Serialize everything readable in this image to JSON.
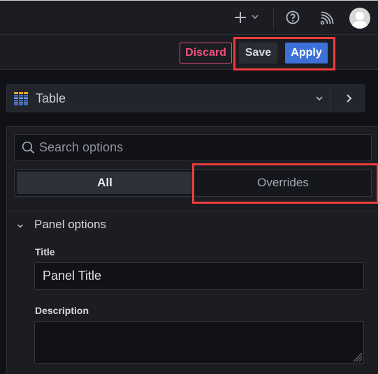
{
  "topbar": {
    "add_icon": "plus-icon",
    "add_menu_icon": "chevron-down-icon",
    "help_icon": "help-circle-icon",
    "news_icon": "rss-icon",
    "profile_icon": "avatar"
  },
  "actions": {
    "discard_label": "Discard",
    "save_label": "Save",
    "apply_label": "Apply",
    "collapse_icon": "chevron-up-icon"
  },
  "visualization": {
    "selected": "Table",
    "icon": "table-viz-icon"
  },
  "options": {
    "search_placeholder": "Search options",
    "search_value": "",
    "tabs": [
      {
        "label": "All",
        "active": true
      },
      {
        "label": "Overrides",
        "active": false
      }
    ],
    "section": {
      "title": "Panel options",
      "expanded": true,
      "fields": {
        "title_label": "Title",
        "title_value": "Panel Title",
        "description_label": "Description",
        "description_value": ""
      }
    }
  },
  "colors": {
    "accent_primary": "#3d71d9",
    "danger": "#f0507e",
    "highlight": "#ee3d3d",
    "background": "#111217",
    "panel": "#1b1d22"
  }
}
